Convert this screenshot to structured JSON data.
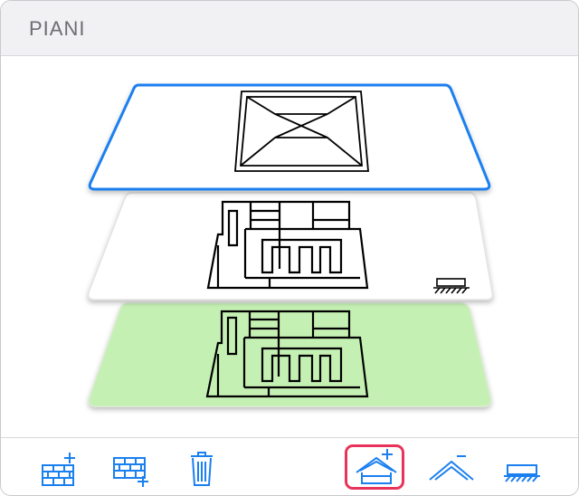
{
  "panel": {
    "title": "PIANI"
  },
  "floors": [
    {
      "name": "roof",
      "selected": true,
      "fill": "#ffffff",
      "border": "#1a7ff0"
    },
    {
      "name": "floor",
      "selected": false,
      "fill": "#ffffff",
      "border": "#e2e2e2"
    },
    {
      "name": "ground-floor",
      "selected": false,
      "fill": "#c5f0b3",
      "border": "#d7ecce"
    }
  ],
  "toolbar": {
    "buttons": [
      {
        "name": "add-floor-above-button",
        "icon": "brick-wall-plus-top-icon"
      },
      {
        "name": "add-floor-below-button",
        "icon": "brick-wall-plus-bottom-icon"
      },
      {
        "name": "delete-floor-button",
        "icon": "trash-icon"
      },
      {
        "name": "add-roof-button",
        "icon": "house-plus-icon",
        "selected": true
      },
      {
        "name": "remove-roof-button",
        "icon": "roof-minus-icon"
      },
      {
        "name": "foundation-button",
        "icon": "foundation-ground-icon"
      }
    ]
  },
  "colors": {
    "accent": "#1a7ff0",
    "selection": "#e8345a",
    "ground_fill": "#c5f0b3",
    "header_bg": "#f1f1f4"
  }
}
